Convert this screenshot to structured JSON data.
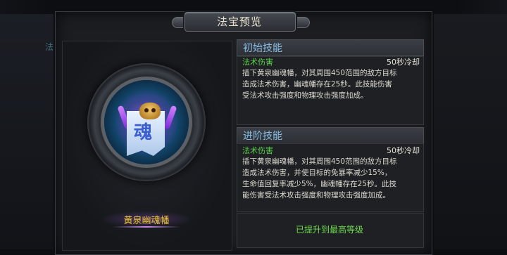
{
  "title": "法宝预览",
  "item": {
    "name": "黄泉幽魂幡",
    "icon": "skull-banner-icon"
  },
  "initial_skill": {
    "header": "初始技能",
    "type": "法术伤害",
    "cooldown": "50秒冷却",
    "desc_lines": [
      "插下黄泉幽魂幡，对其周围450范围的敌方目标",
      "造成法术伤害，幽魂幡存在25秒。此技能伤害",
      "受法术攻击强度和物理攻击强度加成。"
    ]
  },
  "advanced_skill": {
    "header": "进阶技能",
    "type": "法术伤害",
    "cooldown": "50秒冷却",
    "desc_lines": [
      "插下黄泉幽魂幡，对其周围450范围的敌方目标",
      "造成法术伤害，并使目标的免暴率减少15%，",
      "生命值回复率减少5%，幽魂幡存在25秒。此技",
      "能伤害受法术攻击强度和物理攻击强度加成。"
    ]
  },
  "status": "已提升到最高等级",
  "background_label": "法",
  "colors": {
    "header_text": "#86bfe6",
    "skill_type": "#5bd34a",
    "item_name": "#f0c537",
    "status_text": "#6fdd4e"
  }
}
